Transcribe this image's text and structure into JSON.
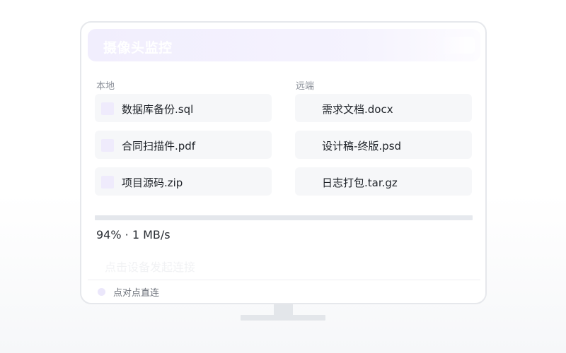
{
  "window": {
    "title": "摄像头监控"
  },
  "local": {
    "label": "本地",
    "files": [
      {
        "name": "数据库备份.sql"
      },
      {
        "name": "合同扫描件.pdf"
      },
      {
        "name": "项目源码.zip"
      }
    ]
  },
  "remote": {
    "label": "远端",
    "files": [
      {
        "name": "需求文档.docx"
      },
      {
        "name": "设计稿-终版.psd"
      },
      {
        "name": "日志打包.tar.gz"
      }
    ]
  },
  "transfer": {
    "progress_percent": 94,
    "status_text": "94% · 1 MB/s"
  },
  "hint": "点击设备发起连接",
  "status": {
    "label": "点对点直连"
  },
  "colors": {
    "accent": "#efebfc",
    "panel": "#f6f7f9",
    "border": "#e6e8ec"
  }
}
